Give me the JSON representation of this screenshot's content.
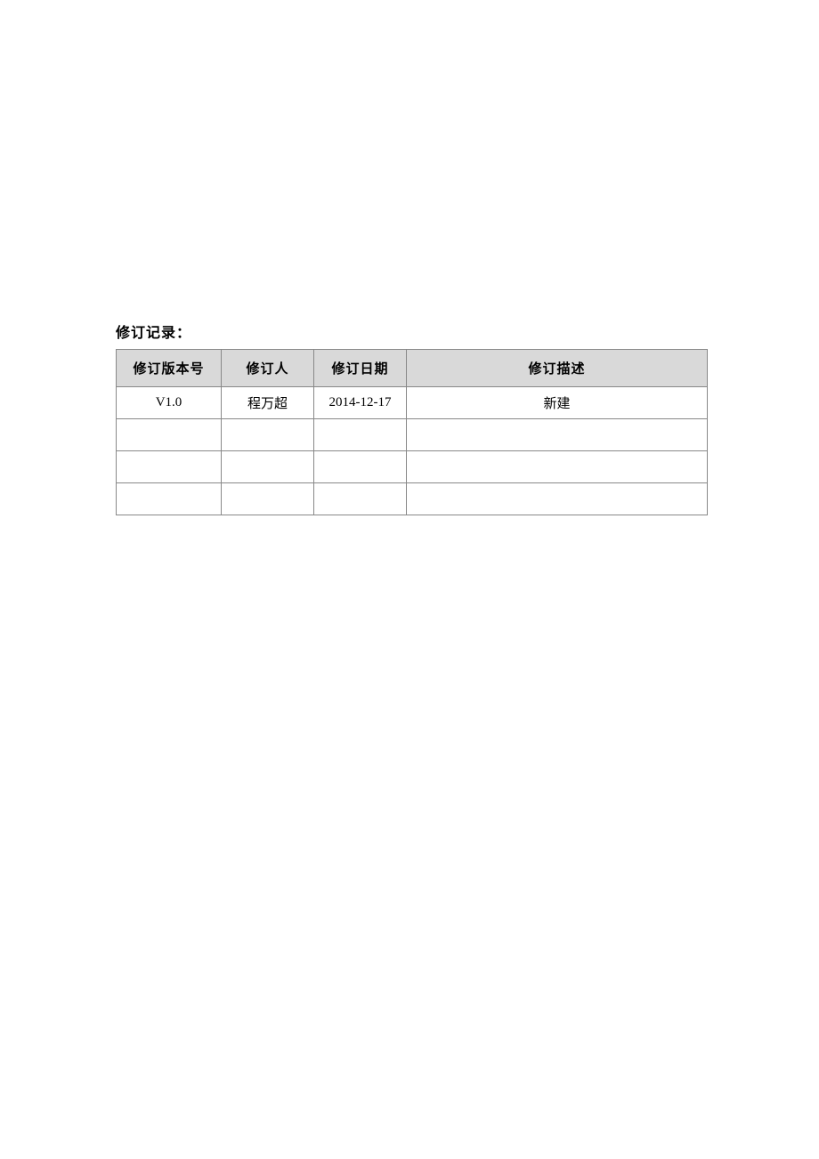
{
  "section_title": "修订记录：",
  "table": {
    "headers": {
      "version": "修订版本号",
      "person": "修订人",
      "date": "修订日期",
      "description": "修订描述"
    },
    "rows": [
      {
        "version": "V1.0",
        "person": "程万超",
        "date": "2014-12-17",
        "description": "新建"
      },
      {
        "version": "",
        "person": "",
        "date": "",
        "description": ""
      },
      {
        "version": "",
        "person": "",
        "date": "",
        "description": ""
      },
      {
        "version": "",
        "person": "",
        "date": "",
        "description": ""
      }
    ]
  }
}
